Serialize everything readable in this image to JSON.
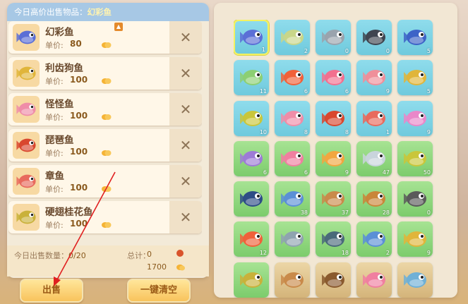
{
  "header": {
    "prefix": "今日高价出售物品：",
    "highlight": "幻彩鱼"
  },
  "sell_list": {
    "price_label": "单价:",
    "remove_symbol": "✕",
    "items": [
      {
        "name": "幻彩鱼",
        "price": "80",
        "color": "#5b6fd6",
        "tagged": true
      },
      {
        "name": "利齿狗鱼",
        "price": "100",
        "color": "#e0b53a",
        "tagged": false
      },
      {
        "name": "怪怪鱼",
        "price": "100",
        "color": "#ef8da8",
        "tagged": false
      },
      {
        "name": "琵琶鱼",
        "price": "100",
        "color": "#d9472e",
        "tagged": false
      },
      {
        "name": "章鱼",
        "price": "100",
        "color": "#e86a5d",
        "tagged": false
      },
      {
        "name": "硬翅桂花鱼",
        "price": "100",
        "color": "#c9b13a",
        "tagged": false
      }
    ]
  },
  "summary": {
    "count_label": "今日出售数量：",
    "count_value": "0/20",
    "total_label": "总计：",
    "total_value": "0",
    "coins_value": "1700"
  },
  "buttons": {
    "sell": "出售",
    "clear": "一键清空"
  },
  "inventory": [
    {
      "qty": "1",
      "bg": "blue",
      "color": "#5b6fd6",
      "selected": true
    },
    {
      "qty": "2",
      "bg": "blue",
      "color": "#c8d68a"
    },
    {
      "qty": "0",
      "bg": "blue",
      "color": "#9aa3ad"
    },
    {
      "qty": "0",
      "bg": "blue",
      "color": "#3f4550"
    },
    {
      "qty": "5",
      "bg": "blue",
      "color": "#3d63c7"
    },
    {
      "qty": "11",
      "bg": "blue",
      "color": "#8ccf73"
    },
    {
      "qty": "6",
      "bg": "blue",
      "color": "#f0613a"
    },
    {
      "qty": "6",
      "bg": "blue",
      "color": "#f2708f"
    },
    {
      "qty": "9",
      "bg": "blue",
      "color": "#ef8f9a"
    },
    {
      "qty": "5",
      "bg": "blue",
      "color": "#e0b53a"
    },
    {
      "qty": "10",
      "bg": "blue",
      "color": "#c9c63a"
    },
    {
      "qty": "8",
      "bg": "blue",
      "color": "#ef8da8"
    },
    {
      "qty": "8",
      "bg": "blue",
      "color": "#d9472e"
    },
    {
      "qty": "1",
      "bg": "blue",
      "color": "#e86a5d"
    },
    {
      "qty": "9",
      "bg": "blue",
      "color": "#e987c9"
    },
    {
      "qty": "6",
      "bg": "green",
      "color": "#9d7bd6"
    },
    {
      "qty": "6",
      "bg": "green",
      "color": "#f07fa0"
    },
    {
      "qty": "9",
      "bg": "green",
      "color": "#f2a640"
    },
    {
      "qty": "47",
      "bg": "green",
      "color": "#c9d4dc"
    },
    {
      "qty": "50",
      "bg": "green",
      "color": "#c9c63a"
    },
    {
      "qty": "",
      "bg": "green",
      "color": "#2e4d86"
    },
    {
      "qty": "38",
      "bg": "green",
      "color": "#5b8fd6"
    },
    {
      "qty": "37",
      "bg": "green",
      "color": "#c98a4a"
    },
    {
      "qty": "28",
      "bg": "green",
      "color": "#c9863a"
    },
    {
      "qty": "0",
      "bg": "green",
      "color": "#5a5a5a"
    },
    {
      "qty": "12",
      "bg": "green",
      "color": "#f0613a"
    },
    {
      "qty": "",
      "bg": "green",
      "color": "#8fa3b0"
    },
    {
      "qty": "18",
      "bg": "green",
      "color": "#4a6a7a"
    },
    {
      "qty": "2",
      "bg": "green",
      "color": "#5b8fd6"
    },
    {
      "qty": "9",
      "bg": "green",
      "color": "#e0b53a"
    },
    {
      "qty": "",
      "bg": "green",
      "color": "#c9b13a"
    },
    {
      "qty": "",
      "bg": "sand",
      "color": "#c98a4a"
    },
    {
      "qty": "",
      "bg": "sand",
      "color": "#8a5a2e"
    },
    {
      "qty": "",
      "bg": "sand",
      "color": "#f07fa0"
    },
    {
      "qty": "",
      "bg": "sand",
      "color": "#6fb0d6"
    }
  ],
  "colors": {
    "header_bg": "#a7c8e5",
    "highlight_text": "#fff3b0",
    "button_bg": "#f8c35c",
    "arrow": "#e02020"
  }
}
